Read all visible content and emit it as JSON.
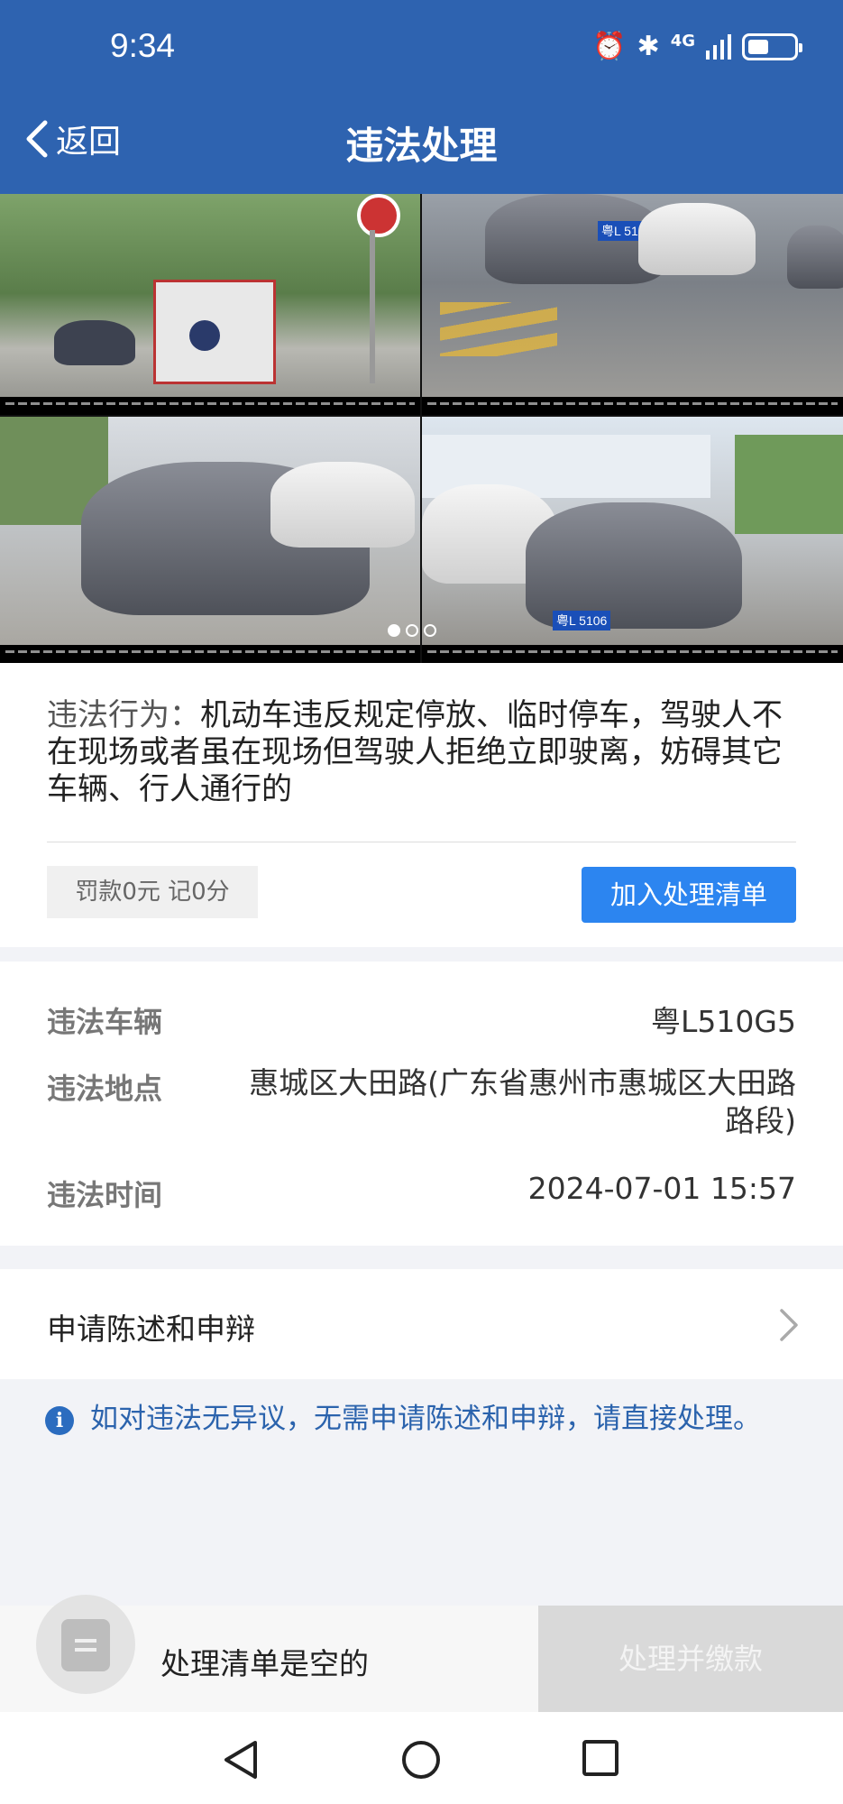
{
  "status_bar": {
    "time": "9:34",
    "network": "4G"
  },
  "header": {
    "back_label": "返回",
    "title": "违法处理"
  },
  "gallery": {
    "plate_text": "粤L 5106"
  },
  "violation": {
    "behavior_label": "违法行为：",
    "behavior_text": "机动车违反规定停放、临时停车，驾驶人不在现场或者虽在现场但驾驶人拒绝立即驶离，妨碍其它车辆、行人通行的",
    "fine_points": "罚款0元 记0分",
    "add_button": "加入处理清单"
  },
  "details": {
    "vehicle_label": "违法车辆",
    "vehicle_value": "粤L510G5",
    "location_label": "违法地点",
    "location_value_line1": "惠城区大田路(广东省惠州市惠城区大田路",
    "location_value_line2": "路段)",
    "time_label": "违法时间",
    "time_value": "2024-07-01 15:57"
  },
  "appeal": {
    "label": "申请陈述和申辩"
  },
  "notice": {
    "text": "如对违法无异议，无需申请陈述和申辩，请直接处理。"
  },
  "bottom": {
    "cart_text": "处理清单是空的",
    "pay_button": "处理并缴款"
  }
}
